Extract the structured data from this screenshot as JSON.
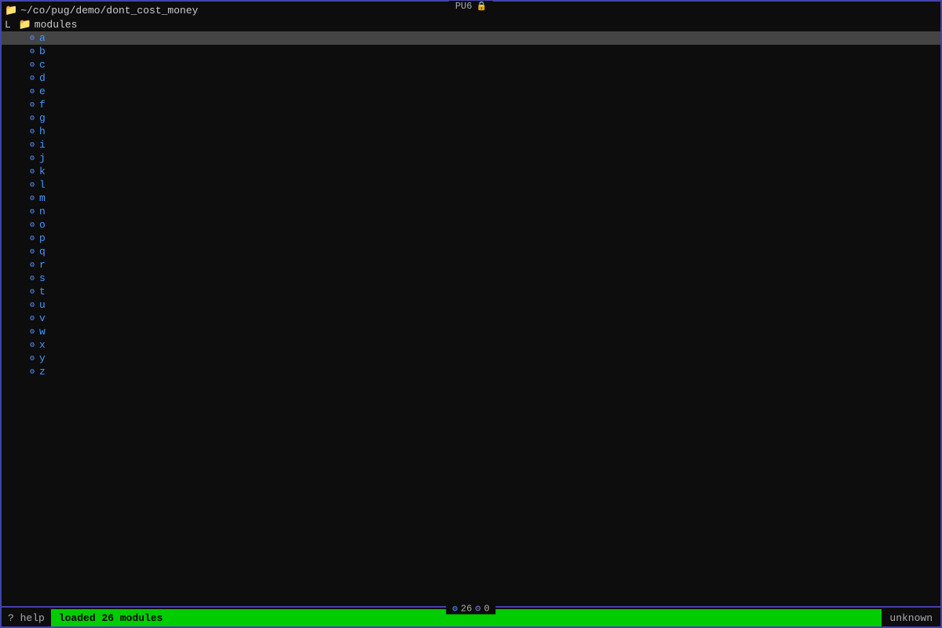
{
  "titleBar": {
    "label": "PU6",
    "shieldSymbol": "🔒"
  },
  "pathRow": {
    "icon": "📁",
    "path": "~/co/pug/demo/dont_cost_money"
  },
  "modulesRow": {
    "treePrefix": "L",
    "icon": "📁",
    "label": "modules"
  },
  "treeItems": [
    {
      "label": "a",
      "selected": true
    },
    {
      "label": "b",
      "selected": false
    },
    {
      "label": "c",
      "selected": false
    },
    {
      "label": "d",
      "selected": false
    },
    {
      "label": "e",
      "selected": false
    },
    {
      "label": "f",
      "selected": false
    },
    {
      "label": "g",
      "selected": false
    },
    {
      "label": "h",
      "selected": false
    },
    {
      "label": "i",
      "selected": false
    },
    {
      "label": "j",
      "selected": false
    },
    {
      "label": "k",
      "selected": false
    },
    {
      "label": "l",
      "selected": false
    },
    {
      "label": "m",
      "selected": false
    },
    {
      "label": "n",
      "selected": false
    },
    {
      "label": "o",
      "selected": false
    },
    {
      "label": "p",
      "selected": false
    },
    {
      "label": "q",
      "selected": false
    },
    {
      "label": "r",
      "selected": false
    },
    {
      "label": "s",
      "selected": false
    },
    {
      "label": "t",
      "selected": false
    },
    {
      "label": "u",
      "selected": false
    },
    {
      "label": "v",
      "selected": false
    },
    {
      "label": "w",
      "selected": false
    },
    {
      "label": "x",
      "selected": false
    },
    {
      "label": "y",
      "selected": false
    },
    {
      "label": "z",
      "selected": false
    }
  ],
  "bottomCenter": {
    "moduleCount": "26",
    "gearSymbol": "⚙",
    "zeroLabel": "0"
  },
  "statusBar": {
    "helpLabel": "?",
    "helpText": "help",
    "message": "loaded 26 modules",
    "unknownLabel": "unknown"
  }
}
